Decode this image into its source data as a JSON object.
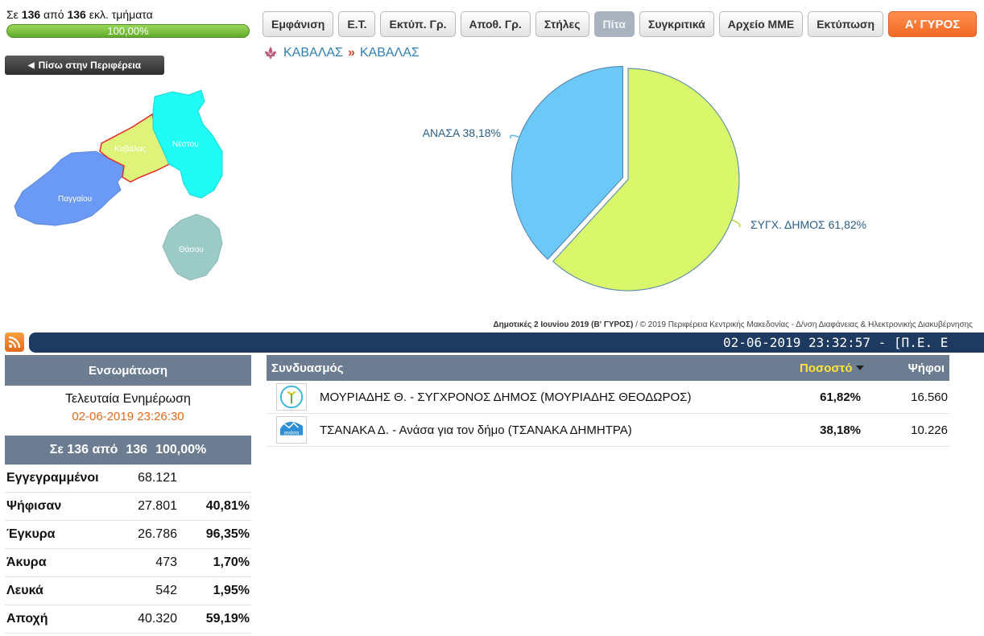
{
  "status": {
    "prefix": "Σε",
    "counted": "136",
    "middle": "από",
    "total": "136",
    "suffix": "εκλ. τμήματα",
    "progress_label": "100,00%",
    "progress_fraction": 1.0
  },
  "toolbar": {
    "buttons": [
      "Εμφάνιση",
      "Ε.Τ.",
      "Εκτύπ. Γρ.",
      "Αποθ. Γρ.",
      "Στήλες",
      "Πίτα",
      "Συγκριτικά",
      "Αρχείο ΜΜΕ",
      "Εκτύπωση"
    ],
    "active": "Πίτα",
    "round_button": "Α' ΓΥΡΟΣ"
  },
  "back_button": "Πίσω στην Περιφέρεια",
  "breadcrumb": {
    "first": "ΚΑΒΑΛΑΣ",
    "separator": "»",
    "second": "ΚΑΒΑΛΑΣ"
  },
  "map": {
    "regions": [
      {
        "name": "Καβάλας",
        "color": "#dff27a"
      },
      {
        "name": "Νέστου",
        "color": "#1ffcf5"
      },
      {
        "name": "Παγγαίου",
        "color": "#6a9af5"
      },
      {
        "name": "Θάσου",
        "color": "#9ccac6"
      }
    ]
  },
  "chart_data": {
    "type": "pie",
    "slices": [
      {
        "label": "ΣΥΓΧ. ΔΗΜΟΣ 61,82%",
        "value": 61.82,
        "color": "#daf76b"
      },
      {
        "label": "ΑΝΑΣΑ 38,18%",
        "value": 38.18,
        "color": "#6cc8f7"
      }
    ]
  },
  "credit": {
    "bold": "Δημοτικές 2 Ιουνίου 2019 (Β' ΓΥΡΟΣ)",
    "rest": "/ © 2019 Περιφέρεια Κεντρικής Μακεδονίας - Δ/νση Διαφάνειας & Ηλεκτρονικής Διακυβέρνησης"
  },
  "ticker": "02-06-2019 23:32:57 - [Π.Ε. Ε",
  "stats": {
    "header": "Ενσωμάτωση",
    "update_label": "Τελευταία Ενημέρωση",
    "update_value": "02-06-2019 23:26:30",
    "summary": {
      "text": "Σε 136 από",
      "count": "136",
      "percent": "100,00%"
    },
    "rows": [
      {
        "label": "Εγγεγραμμένοι",
        "number": "68.121",
        "percent": ""
      },
      {
        "label": "Ψήφισαν",
        "number": "27.801",
        "percent": "40,81%"
      },
      {
        "label": "Έγκυρα",
        "number": "26.786",
        "percent": "96,35%"
      },
      {
        "label": "Άκυρα",
        "number": "473",
        "percent": "1,70%"
      },
      {
        "label": "Λευκά",
        "number": "542",
        "percent": "1,95%"
      },
      {
        "label": "Αποχή",
        "number": "40.320",
        "percent": "59,19%"
      }
    ]
  },
  "results": {
    "headers": {
      "combination": "Συνδυασμός",
      "percent": "Ποσοστό",
      "votes": "Ψήφοι"
    },
    "rows": [
      {
        "name": "ΜΟΥΡΙΑΔΗΣ Θ. - ΣΥΓΧΡΟΝΟΣ ΔΗΜΟΣ (ΜΟΥΡΙΑΔΗΣ ΘΕΟΔΩΡΟΣ)",
        "percent": "61,82%",
        "votes": "16.560"
      },
      {
        "name": "ΤΣΑΝΑΚΑ Δ. - Ανάσα για τον δήμο (ΤΣΑΝΑΚΑ ΔΗΜΗΤΡΑ)",
        "percent": "38,18%",
        "votes": "10.226",
        "logo_text": "ανάσα"
      }
    ]
  }
}
